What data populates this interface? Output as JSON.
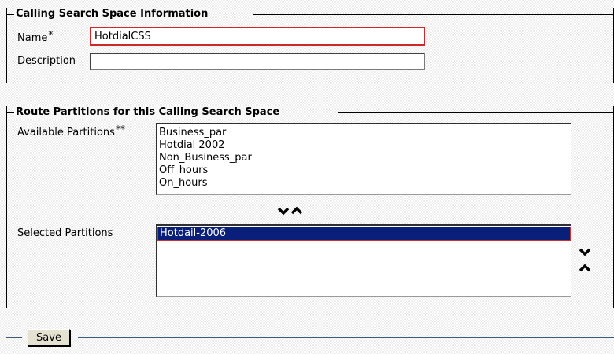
{
  "css_info": {
    "legend": "Calling Search Space Information",
    "name_label": "Name",
    "name_required_mark": "*",
    "name_value": "HotdialCSS",
    "description_label": "Description",
    "description_value": ""
  },
  "partitions": {
    "legend": "Route Partitions for this Calling Search Space",
    "available_label": "Available Partitions",
    "available_required_mark": "**",
    "available_items": [
      "Business_par",
      "Hotdial 2002",
      "Non_Business_par",
      "Off_hours",
      "On_hours"
    ],
    "selected_label": "Selected Partitions",
    "selected_items": [
      "Hotdail-2006"
    ]
  },
  "actions": {
    "save_label": "Save"
  },
  "colors": {
    "selected_bg": "#0a1f7a",
    "required_border": "#cc2a2a"
  }
}
